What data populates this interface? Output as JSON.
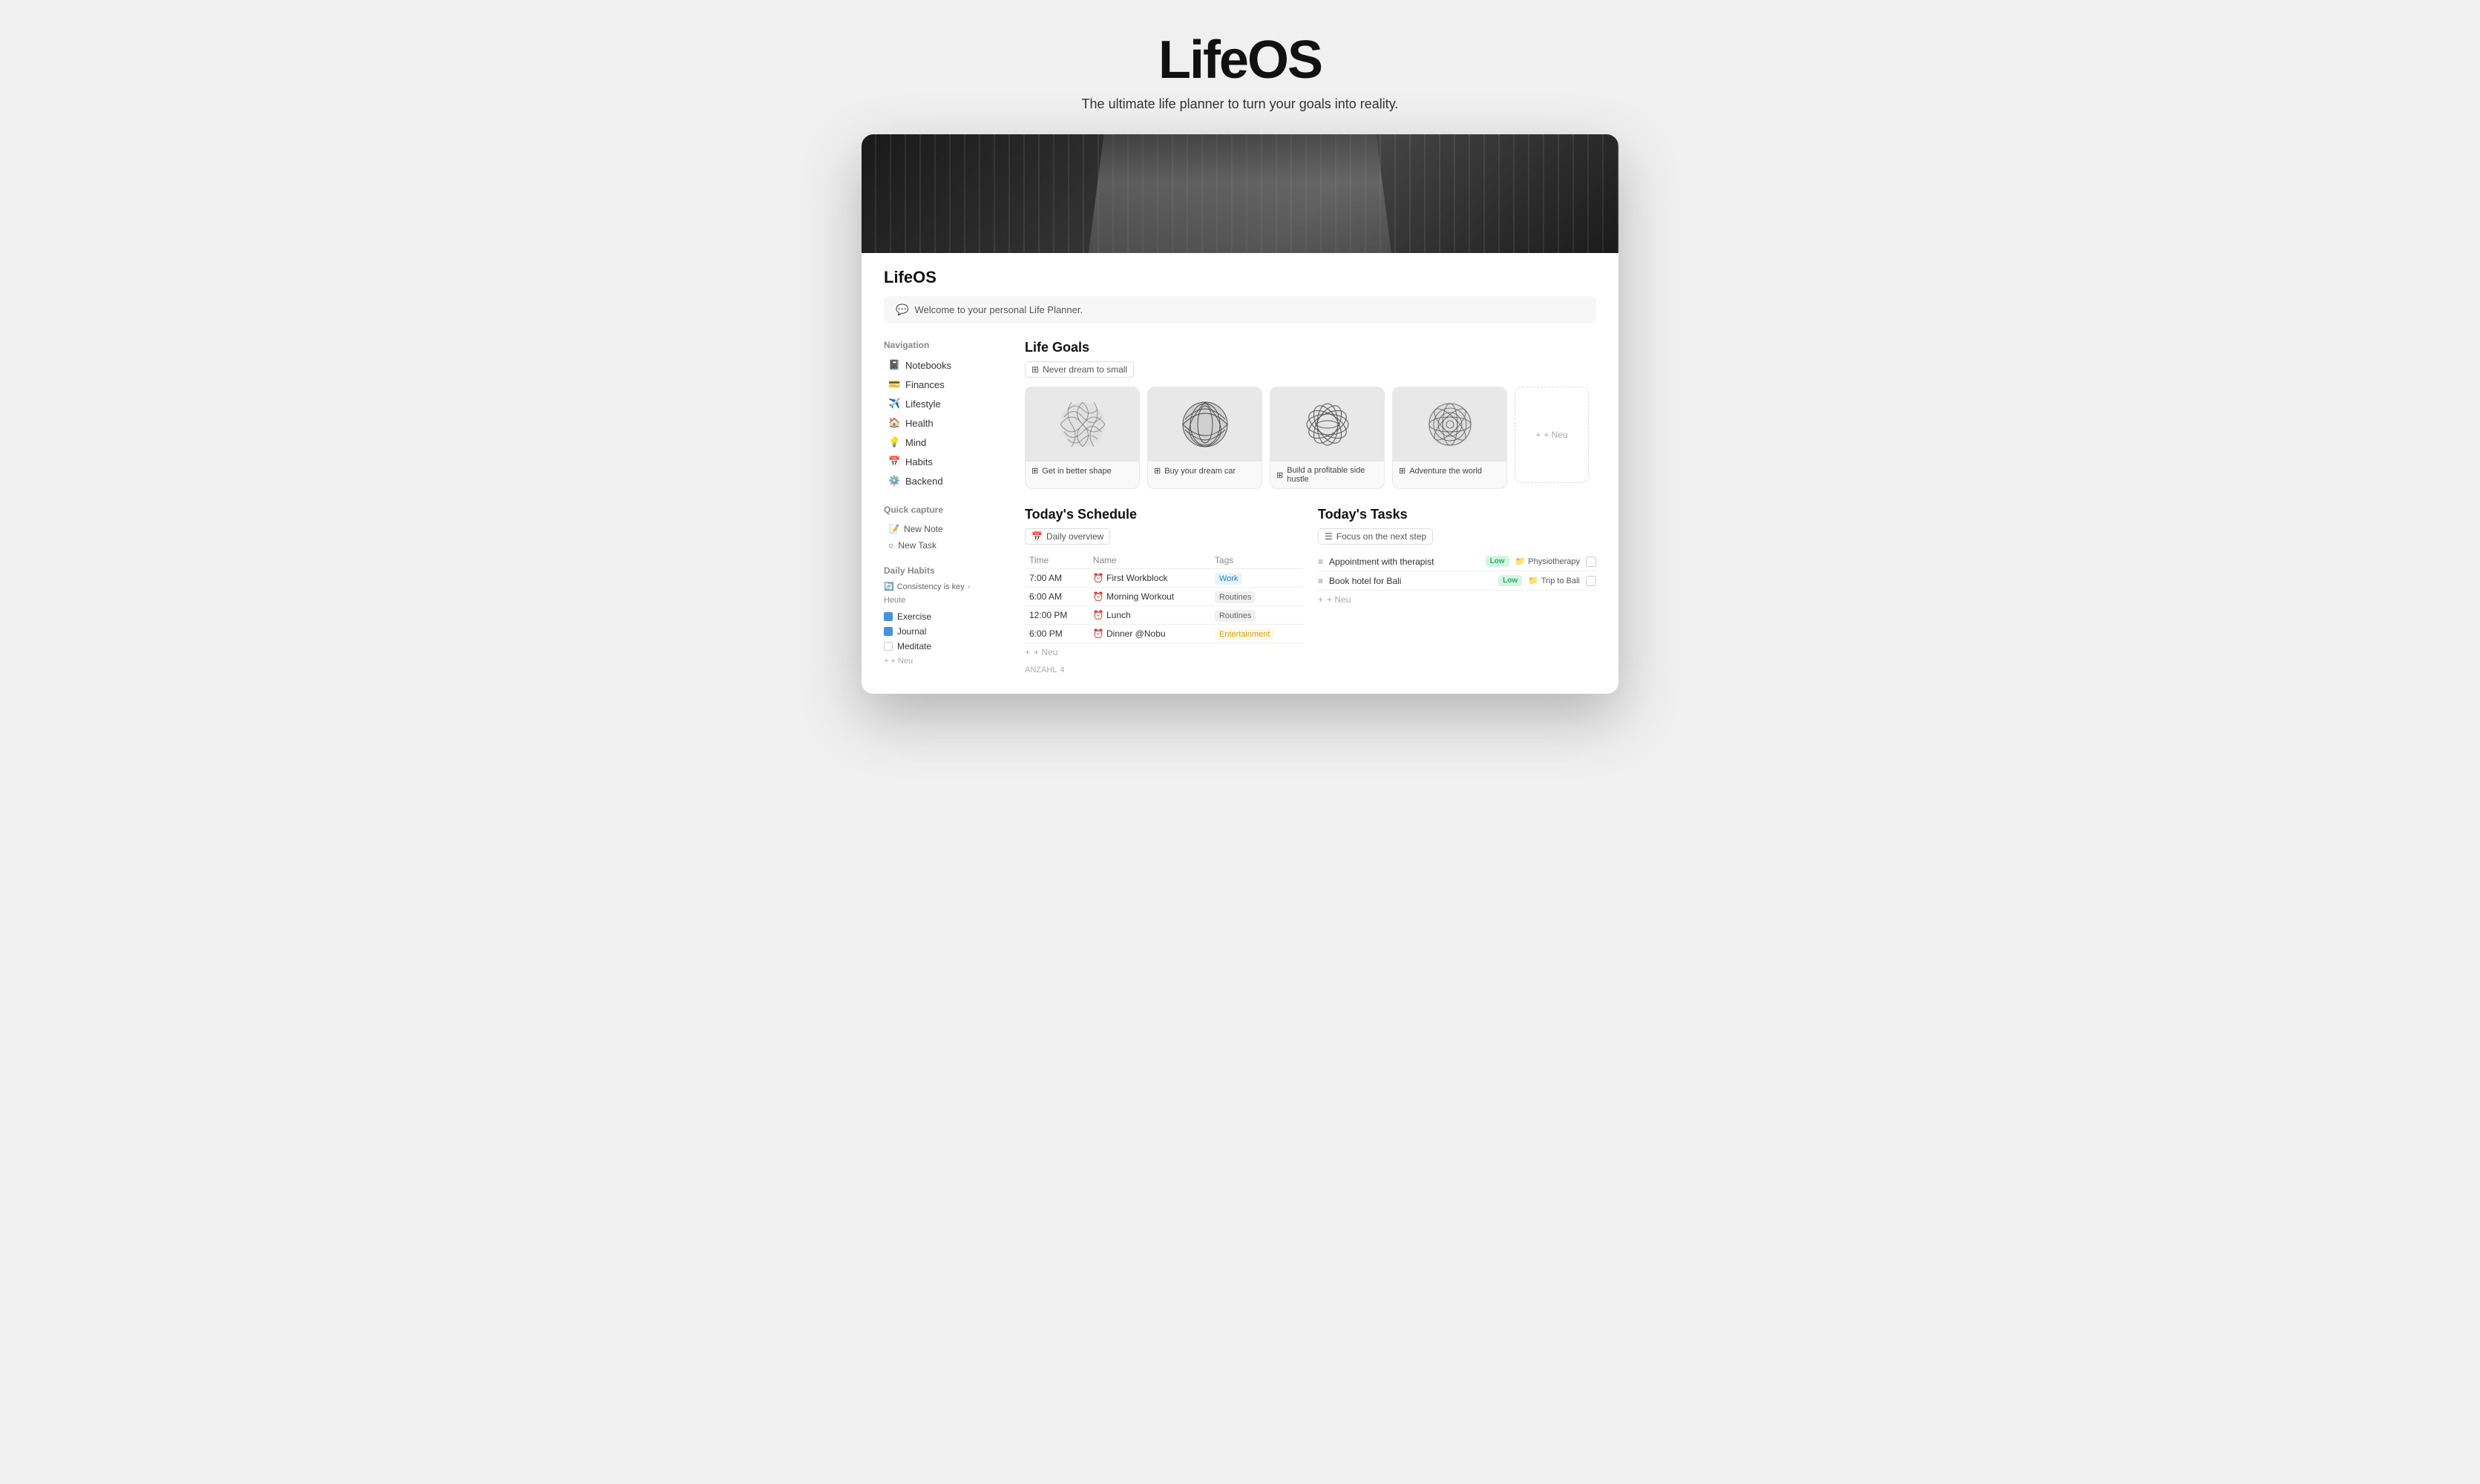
{
  "header": {
    "title": "LifeOS",
    "subtitle": "The ultimate life planner to turn your goals into reality."
  },
  "app": {
    "name": "LifeOS",
    "welcome": "Welcome to your personal Life Planner."
  },
  "sidebar": {
    "navigation_title": "Navigation",
    "items": [
      {
        "icon": "📓",
        "label": "Notebooks",
        "id": "notebooks"
      },
      {
        "icon": "💳",
        "label": "Finances",
        "id": "finances"
      },
      {
        "icon": "✈️",
        "label": "Lifestyle",
        "id": "lifestyle"
      },
      {
        "icon": "🏠",
        "label": "Health",
        "id": "health"
      },
      {
        "icon": "💡",
        "label": "Mind",
        "id": "mind"
      },
      {
        "icon": "📅",
        "label": "Habits",
        "id": "habits"
      },
      {
        "icon": "⚙️",
        "label": "Backend",
        "id": "backend"
      }
    ],
    "quick_capture_title": "Quick capture",
    "quick_capture_items": [
      {
        "icon": "📝",
        "label": "New Note",
        "id": "new-note"
      },
      {
        "icon": "○",
        "label": "New Task",
        "id": "new-task"
      }
    ],
    "daily_habits_title": "Daily Habits",
    "consistency_label": "Consistency is key",
    "habits_days": "Heute",
    "habits": [
      {
        "label": "Exercise",
        "checked": true
      },
      {
        "label": "Journal",
        "checked": true
      },
      {
        "label": "Meditate",
        "checked": false
      }
    ],
    "add_label": "+ Neu"
  },
  "life_goals": {
    "title": "Life Goals",
    "filter": "Never dream to small",
    "goals": [
      {
        "label": "Get in better shape",
        "id": "goal-shape"
      },
      {
        "label": "Buy your dream car",
        "id": "goal-car"
      },
      {
        "label": "Build a profitable side hustle",
        "id": "goal-hustle"
      },
      {
        "label": "Adventure the world",
        "id": "goal-adventure"
      }
    ],
    "new_label": "+ Neu"
  },
  "schedule": {
    "title": "Today's Schedule",
    "filter": "Daily overview",
    "columns": {
      "time": "Time",
      "name": "Name",
      "tags": "Tags"
    },
    "rows": [
      {
        "time": "7:00 AM",
        "name": "First Workblock",
        "tag": "Work",
        "tag_type": "work"
      },
      {
        "time": "6:00 AM",
        "name": "Morning Workout",
        "tag": "Routines",
        "tag_type": "routines"
      },
      {
        "time": "12:00 PM",
        "name": "Lunch",
        "tag": "Routines",
        "tag_type": "routines"
      },
      {
        "time": "6:00 PM",
        "name": "Dinner @Nobu",
        "tag": "Entertainment",
        "tag_type": "entertainment"
      }
    ],
    "add_label": "+ Neu",
    "count_label": "ANZAHL",
    "count_value": "4"
  },
  "tasks": {
    "title": "Today's Tasks",
    "filter": "Focus on the next step",
    "items": [
      {
        "label": "Appointment with therapist",
        "priority": "Low",
        "category": "Physiotherapy"
      },
      {
        "label": "Book hotel for Bali",
        "priority": "Low",
        "category": "Trip to Bali"
      }
    ],
    "add_label": "+ Neu"
  }
}
